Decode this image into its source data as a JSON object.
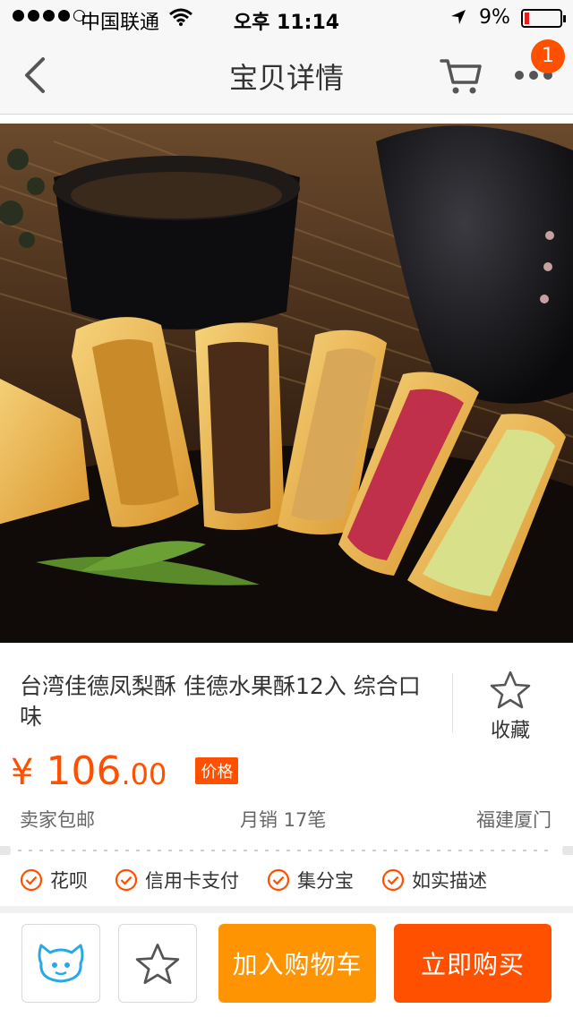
{
  "status_bar": {
    "carrier": "中国联通",
    "time": "오후 11:14",
    "battery": "9%"
  },
  "nav": {
    "title": "宝贝详情",
    "cart_badge": "1",
    "icons": {
      "back": "back-icon",
      "cart": "cart-icon",
      "more": "more-icon"
    }
  },
  "product": {
    "name": "台湾佳德凤梨酥 佳德水果酥12入 综合口味",
    "favorite_label": "收藏",
    "currency": "¥",
    "price_int": "106",
    "price_dec": ".00",
    "price_tag": "价格",
    "shipping": "卖家包邮",
    "monthly_sales": "月销 17笔",
    "location": "福建厦门"
  },
  "guarantees": [
    "花呗",
    "信用卡支付",
    "集分宝",
    "如实描述"
  ],
  "bottom_bar": {
    "add_to_cart": "加入购物车",
    "buy_now": "立即购买",
    "icons": {
      "chat": "chat-icon",
      "favorite": "star-icon"
    }
  },
  "colors": {
    "accent": "#ff5000",
    "cart_button": "#ff9402"
  }
}
